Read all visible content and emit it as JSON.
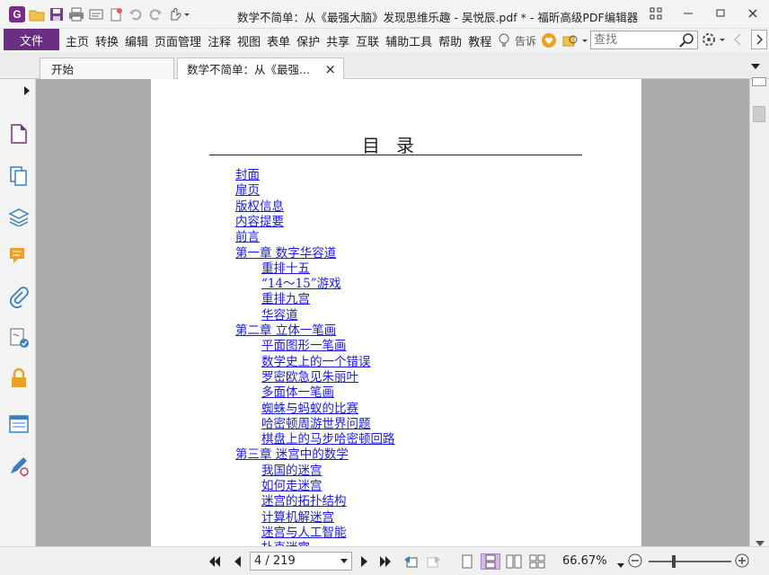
{
  "window": {
    "title": "数学不简单：从《最强大脑》发现思维乐趣 - 吴悦辰.pdf * - 福昕高级PDF编辑器"
  },
  "menu": {
    "file": "文件",
    "items": [
      "主页",
      "转换",
      "编辑",
      "页面管理",
      "注释",
      "视图",
      "表单",
      "保护",
      "共享",
      "互联",
      "辅助工具",
      "帮助",
      "教程"
    ],
    "tell_me": "告诉",
    "search_placeholder": "查找"
  },
  "tabs": [
    {
      "label": "开始"
    },
    {
      "label": "数学不简单：从《最强...",
      "close": "×"
    }
  ],
  "document": {
    "toc_title": "目录",
    "toc": [
      {
        "text": "封面",
        "level": 0
      },
      {
        "text": "扉页",
        "level": 0
      },
      {
        "text": "版权信息",
        "level": 0
      },
      {
        "text": "内容提要",
        "level": 0
      },
      {
        "text": "前言",
        "level": 0
      },
      {
        "text": "第一章 数字华容道",
        "level": 0
      },
      {
        "text": "重排十五",
        "level": 1
      },
      {
        "text": "“14～15”游戏",
        "level": 1
      },
      {
        "text": "重排九宫",
        "level": 1
      },
      {
        "text": "华容道",
        "level": 1
      },
      {
        "text": "第二章 立体一笔画",
        "level": 0
      },
      {
        "text": "平面图形一笔画",
        "level": 1
      },
      {
        "text": "数学史上的一个错误",
        "level": 1
      },
      {
        "text": "罗密欧急见朱丽叶",
        "level": 1
      },
      {
        "text": "多面体一笔画",
        "level": 1
      },
      {
        "text": "蜘蛛与蚂蚁的比赛",
        "level": 1
      },
      {
        "text": "哈密顿周游世界问题",
        "level": 1
      },
      {
        "text": "棋盘上的马步哈密顿回路",
        "level": 1
      },
      {
        "text": "第三章 迷宫中的数学",
        "level": 0
      },
      {
        "text": "我国的迷宫",
        "level": 1
      },
      {
        "text": "如何走迷宫",
        "level": 1
      },
      {
        "text": "迷宫的拓扑结构",
        "level": 1
      },
      {
        "text": "计算机解迷宫",
        "level": 1
      },
      {
        "text": "迷宫与人工智能",
        "level": 1
      },
      {
        "text": "扑克迷宫",
        "level": 1
      }
    ]
  },
  "status": {
    "page_indicator": "4 / 219",
    "zoom": "66.67%",
    "zoom_fraction": 0.3
  },
  "colors": {
    "brand": "#6a2e80",
    "link": "#1a1ae6",
    "doc_background": "#ababab"
  }
}
